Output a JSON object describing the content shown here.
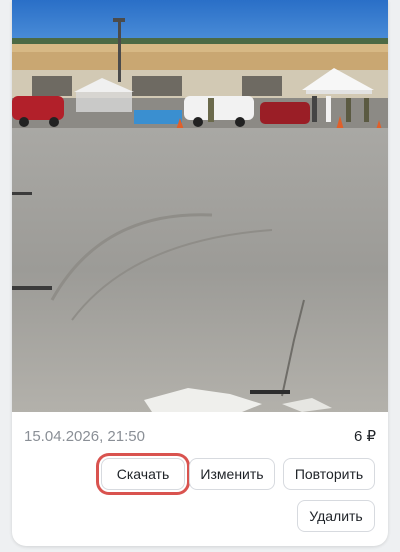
{
  "order": {
    "datetime": "15.04.2026, 21:50",
    "price": "6 ₽"
  },
  "actions": {
    "download_label": "Скачать",
    "edit_label": "Изменить",
    "repeat_label": "Повторить",
    "delete_label": "Удалить"
  },
  "colors": {
    "highlight": "#d9534f",
    "sky": "#2f74c9"
  }
}
